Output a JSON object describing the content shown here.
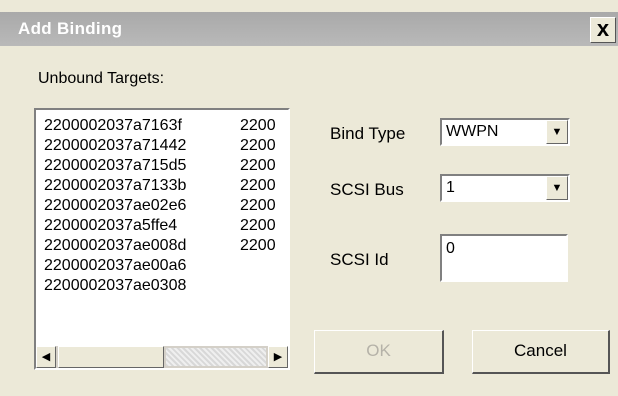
{
  "dialog": {
    "title": "Add Binding",
    "close_label": "x"
  },
  "unbound_targets": {
    "label": "Unbound Targets:",
    "column1": [
      "2200002037a7163f",
      "2200002037a71442",
      "2200002037a715d5",
      "2200002037a7133b",
      "2200002037ae02e6",
      "2200002037a5ffe4",
      "2200002037ae008d",
      "2200002037ae00a6",
      "2200002037ae0308"
    ],
    "column2": [
      "2200",
      "2200",
      "2200",
      "2200",
      "2200",
      "2200",
      "2200"
    ]
  },
  "fields": {
    "bind_type_label": "Bind Type",
    "bind_type_value": "WWPN",
    "scsi_bus_label": "SCSI Bus",
    "scsi_bus_value": "1",
    "scsi_id_label": "SCSI Id",
    "scsi_id_value": "0"
  },
  "buttons": {
    "ok_label": "OK",
    "cancel_label": "Cancel"
  },
  "icons": {
    "dropdown": "chevron-down-icon",
    "scroll_left": "arrow-left-icon",
    "scroll_right": "arrow-right-icon"
  }
}
